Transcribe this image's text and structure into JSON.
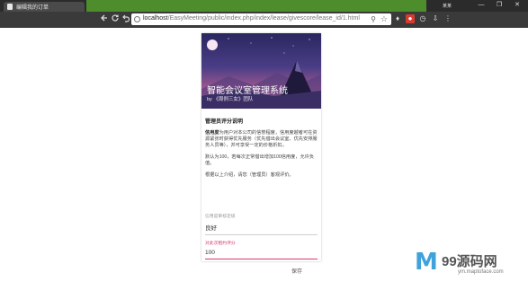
{
  "browser": {
    "tab_title": "编辑我的订单",
    "user_chip": "某某",
    "window_controls": [
      "—",
      "❐",
      "✕"
    ],
    "nav_icons": [
      "arrow-left-icon",
      "reload-icon",
      "undo-icon"
    ],
    "url_host": "localhost",
    "url_path": "/EasyMeeting/public/index.php/index/lease/givescore/lease_id/1.html",
    "extensions": [
      "extension-puzzle-icon",
      "red-extension-icon",
      "clock-icon",
      "download-icon",
      "menu-icon"
    ]
  },
  "app": {
    "title": "智能会议室管理系统",
    "subtitle": "by 《周例三女》团队"
  },
  "content": {
    "heading": "管理员评分说明",
    "para1_bold": "信用度",
    "para1_rest": "为用户对本公司的信誉程度，信用度越者可在资源紧张时获得优先服务（优先借出会议室、优先安排服务人员等），并可享受一定的价格折扣。",
    "para2": "默认为100，若每次正常借出增加100信用度，允许负值。",
    "para3": "根据以上介绍，请您（管理员）客观评价。"
  },
  "form": {
    "field1_label": "信用度审核定级",
    "field1_value": "良好",
    "field2_label": "对此次租约评分",
    "field2_value": "100",
    "save_label": "保存"
  },
  "watermark": {
    "logo": "M",
    "text": "99源码网",
    "url": "ym.maptoface.com"
  },
  "colors": {
    "accent_pink": "#d8386c",
    "chrome_green": "#4e8d2b",
    "watermark_blue": "#3fa2da"
  }
}
